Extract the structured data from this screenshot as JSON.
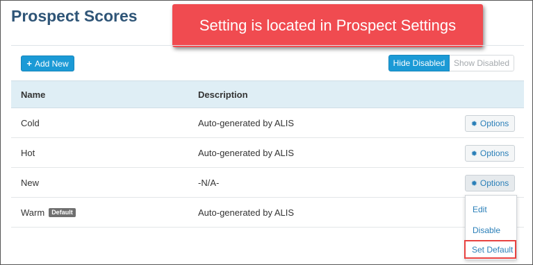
{
  "page": {
    "title": "Prospect Scores",
    "callout": "Setting is located in Prospect Settings"
  },
  "toolbar": {
    "add_new_label": "Add New",
    "hide_disabled_label": "Hide Disabled",
    "show_disabled_label": "Show Disabled"
  },
  "table": {
    "headers": {
      "name": "Name",
      "description": "Description"
    },
    "options_label": "Options",
    "rows": [
      {
        "name": "Cold",
        "description": "Auto-generated by ALIS",
        "badge": ""
      },
      {
        "name": "Hot",
        "description": "Auto-generated by ALIS",
        "badge": ""
      },
      {
        "name": "New",
        "description": "-N/A-",
        "badge": ""
      },
      {
        "name": "Warm",
        "description": "Auto-generated by ALIS",
        "badge": "Default"
      }
    ]
  },
  "dropdown": {
    "items": [
      "Edit",
      "Disable",
      "Set Default"
    ]
  },
  "colors": {
    "primary": "#1b9ad6",
    "callout": "#f04b50",
    "title": "#2f5577",
    "link": "#2a7fb8",
    "highlight": "#e8413f"
  },
  "icons": {
    "add": "plus-icon",
    "options": "gear-icon"
  }
}
